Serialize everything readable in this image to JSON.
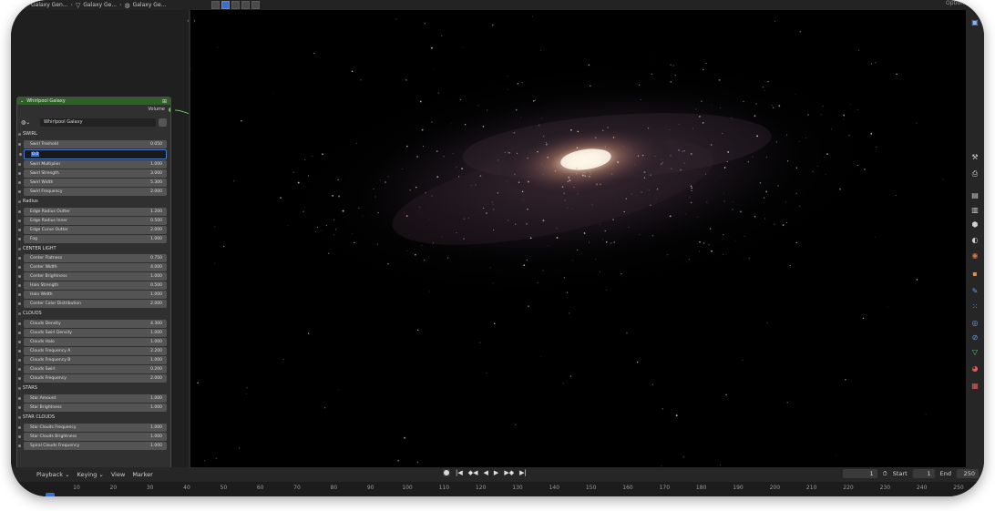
{
  "breadcrumb": [
    {
      "icon": "scene-icon",
      "label": "Galaxy Gen..."
    },
    {
      "icon": "mesh-icon",
      "label": "Galaxy Ge..."
    },
    {
      "icon": "world-icon",
      "label": "Galaxy Ge..."
    }
  ],
  "topright": {
    "label": "Option"
  },
  "node": {
    "title": "Whirlpool Galaxy",
    "output_label": "Volume",
    "datablock": "Whirlpool Galaxy",
    "sections": [
      {
        "label": "SWIRL",
        "fields": [
          {
            "label": "Swirl Treshold",
            "value": "0.050"
          },
          {
            "label": "",
            "value": "",
            "editing": true,
            "edit_text": "0.0"
          },
          {
            "label": "Swirl Multiplier",
            "value": "1.000"
          },
          {
            "label": "Swirl Strength",
            "value": "3.000"
          },
          {
            "label": "Swirl Width",
            "value": "5.300"
          },
          {
            "label": "Swirl Frequency",
            "value": "2.000"
          }
        ]
      },
      {
        "label": "Radius",
        "fields": [
          {
            "label": "Edge Radius Outter",
            "value": "1.200"
          },
          {
            "label": "Edge Radius Inner",
            "value": "0.500"
          },
          {
            "label": "Edge Curve Outter",
            "value": "2.000"
          },
          {
            "label": "Fog",
            "value": "1.000"
          }
        ]
      },
      {
        "label": "CENTER LIGHT",
        "fields": [
          {
            "label": "Center Flatness",
            "value": "0.750"
          },
          {
            "label": "Center Width",
            "value": "4.000"
          },
          {
            "label": "Center Brightness",
            "value": "1.000"
          },
          {
            "label": "Halo Strength",
            "value": "0.500"
          },
          {
            "label": "Halo Width",
            "value": "1.000"
          },
          {
            "label": "Center Color Distribution",
            "value": "2.000"
          }
        ]
      },
      {
        "label": "CLOUDS",
        "fields": [
          {
            "label": "Clouds Density",
            "value": "4.300"
          },
          {
            "label": "Clouds Swirl Density",
            "value": "1.000"
          },
          {
            "label": "Clouds Halo",
            "value": "1.000"
          },
          {
            "label": "Clouds Frequency A",
            "value": "2.200"
          },
          {
            "label": "Clouds Frequency B",
            "value": "1.000"
          },
          {
            "label": "Clouds Swirl",
            "value": "0.200"
          },
          {
            "label": "Clouds Frequency",
            "value": "2.000"
          }
        ]
      },
      {
        "label": "STARS",
        "fields": [
          {
            "label": "Star Amount",
            "value": "1.000"
          },
          {
            "label": "Star Brightness",
            "value": "1.000"
          }
        ]
      },
      {
        "label": "STAR CLOUDS",
        "fields": [
          {
            "label": "Star Clouds Frequency",
            "value": "1.000"
          },
          {
            "label": "Star Clouds Brightness",
            "value": "1.000"
          },
          {
            "label": "Spiral Clouds Frequency",
            "value": "1.000"
          }
        ]
      }
    ]
  },
  "timeline": {
    "menu": [
      "Playback ⌄",
      "Keying ⌄",
      "View",
      "Marker"
    ],
    "current_frame": "1",
    "start_label": "Start",
    "start": "1",
    "end_label": "End",
    "end": "250",
    "ruler": [
      "10",
      "20",
      "30",
      "40",
      "50",
      "60",
      "70",
      "80",
      "90",
      "100",
      "110",
      "120",
      "130",
      "140",
      "150",
      "160",
      "170",
      "180",
      "190",
      "200",
      "210",
      "220",
      "230",
      "240",
      "250"
    ]
  },
  "colors": {
    "node_header": "#315f2a",
    "socket_volume": "#62c36b",
    "accent": "#3b6fc8"
  }
}
